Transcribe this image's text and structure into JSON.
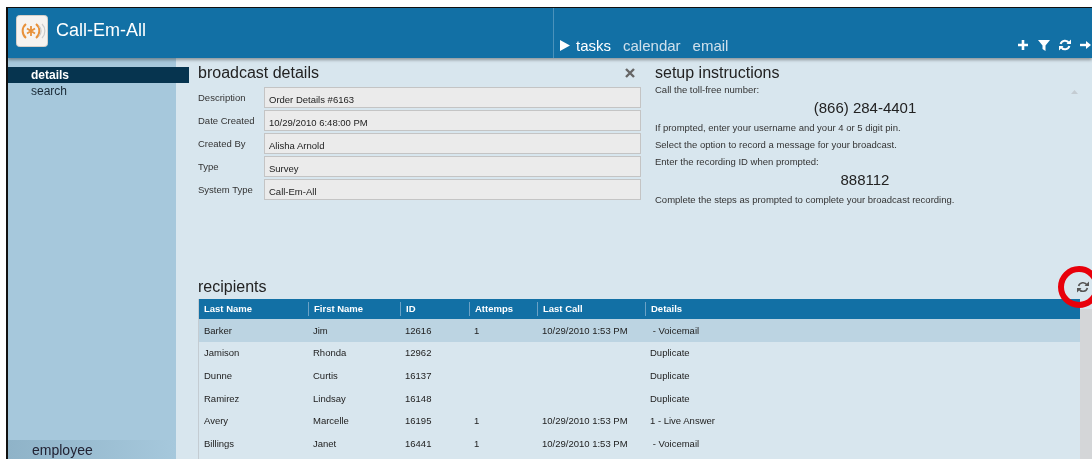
{
  "app": {
    "title": "Call-Em-All"
  },
  "nav": [
    {
      "label": "tasks",
      "selected": true
    },
    {
      "label": "calendar",
      "selected": false
    },
    {
      "label": "email",
      "selected": false
    }
  ],
  "toolbar": [
    {
      "kind": "add"
    },
    {
      "kind": "filter"
    },
    {
      "kind": "refresh"
    },
    {
      "kind": "exit"
    }
  ],
  "sidebar": {
    "items": [
      {
        "label": "details",
        "selected": true
      },
      {
        "label": "search",
        "selected": false
      }
    ],
    "footer": "employee"
  },
  "broadcast_details": {
    "title": "broadcast details",
    "fields": [
      {
        "label": "Description",
        "value": "Order Details #6163"
      },
      {
        "label": "Date Created",
        "value": "10/29/2010 6:48:00 PM"
      },
      {
        "label": "Created By",
        "value": "Alisha Arnold"
      },
      {
        "label": "Type",
        "value": "Survey"
      },
      {
        "label": "System Type",
        "value": "Call-Em-All"
      }
    ]
  },
  "setup_instructions": {
    "title": "setup instructions",
    "lines": [
      {
        "kind": "text",
        "text": "Call the toll-free number:"
      },
      {
        "kind": "big",
        "text": "(866) 284-4401"
      },
      {
        "kind": "text",
        "text": "If prompted, enter your username and your 4 or 5 digit pin."
      },
      {
        "kind": "text",
        "text": "Select the option to record a message for your broadcast."
      },
      {
        "kind": "text",
        "text": "Enter the recording ID when prompted:"
      },
      {
        "kind": "big",
        "text": "888112"
      },
      {
        "kind": "text",
        "text": "Complete the steps as prompted to complete your broadcast recording."
      }
    ]
  },
  "recipients": {
    "title": "recipients",
    "columns": [
      "Last Name",
      "First Name",
      "ID",
      "Attemps",
      "Last Call",
      "Details"
    ],
    "rows": [
      {
        "cells": [
          "Barker",
          "Jim",
          "12616",
          "1",
          "10/29/2010 1:53 PM",
          " - Voicemail"
        ],
        "selected": true
      },
      {
        "cells": [
          "Jamison",
          "Rhonda",
          "12962",
          "",
          "",
          "Duplicate"
        ],
        "selected": false
      },
      {
        "cells": [
          "Dunne",
          "Curtis",
          "16137",
          "",
          "",
          "Duplicate"
        ],
        "selected": false
      },
      {
        "cells": [
          "Ramirez",
          "Lindsay",
          "16148",
          "",
          "",
          "Duplicate"
        ],
        "selected": false
      },
      {
        "cells": [
          "Avery",
          "Marcelle",
          "16195",
          "1",
          "10/29/2010 1:53 PM",
          "1 - Live Answer"
        ],
        "selected": false
      },
      {
        "cells": [
          "Billings",
          "Janet",
          "16441",
          "1",
          "10/29/2010 1:53 PM",
          " - Voicemail"
        ],
        "selected": false
      }
    ]
  }
}
